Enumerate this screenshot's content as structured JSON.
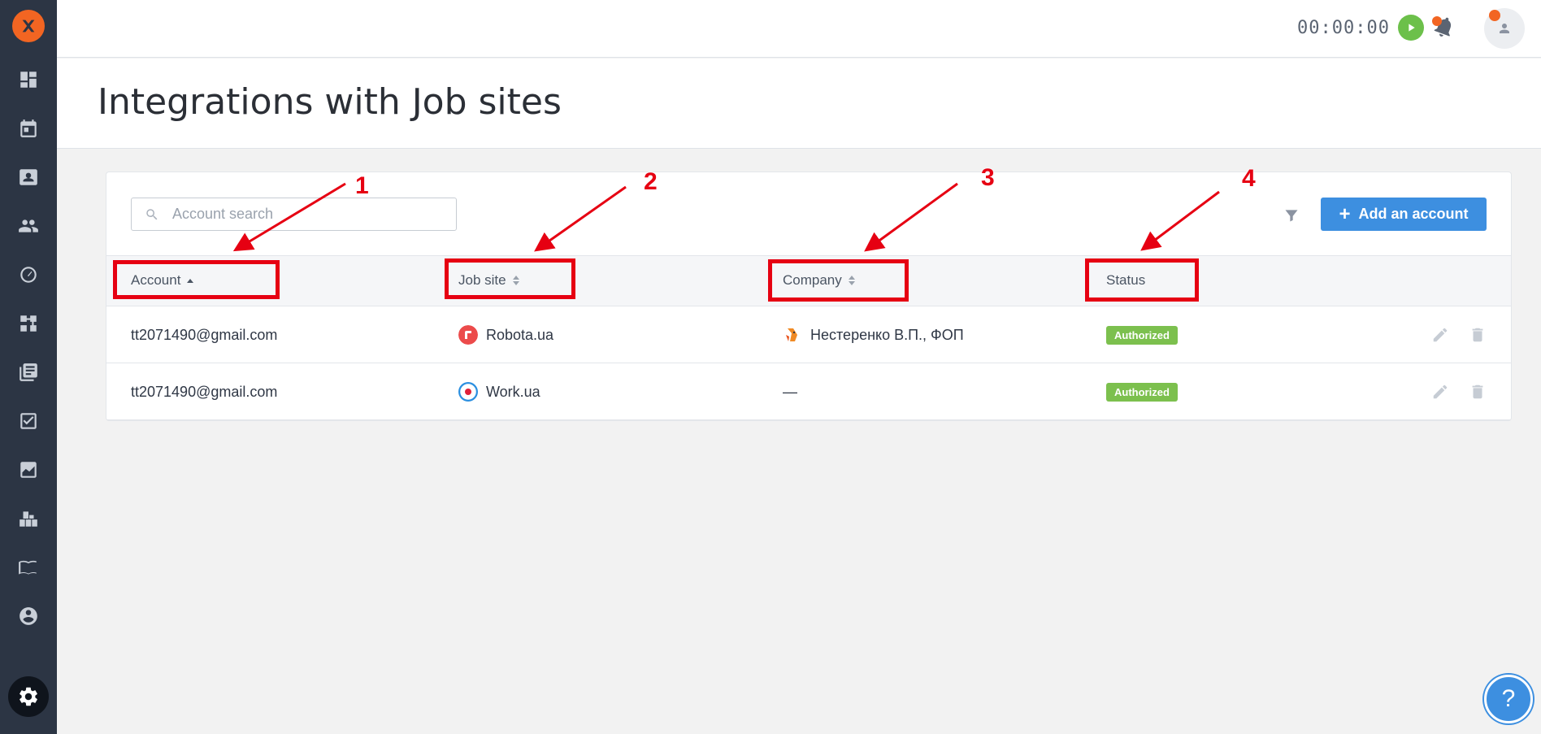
{
  "topbar": {
    "timer": "00:00:00"
  },
  "page": {
    "title": "Integrations with Job sites"
  },
  "search": {
    "placeholder": "Account search",
    "value": ""
  },
  "toolbar": {
    "add_label": "Add an account"
  },
  "table": {
    "columns": {
      "account": "Account",
      "job_site": "Job site",
      "company": "Company",
      "status": "Status"
    },
    "rows": [
      {
        "account": "tt2071490@gmail.com",
        "job_site": "Robota.ua",
        "company": "Нестеренко В.П., ФОП",
        "status": "Authorized"
      },
      {
        "account": "tt2071490@gmail.com",
        "job_site": "Work.ua",
        "company": "—",
        "status": "Authorized"
      }
    ]
  },
  "annotations": [
    "1",
    "2",
    "3",
    "4"
  ],
  "help": {
    "label": "?"
  },
  "colors": {
    "sidebar": "#2c3544",
    "accent": "#3d8fe0",
    "brand": "#f26522",
    "status_authorized": "#7cc04e",
    "annotation": "#e60012"
  }
}
